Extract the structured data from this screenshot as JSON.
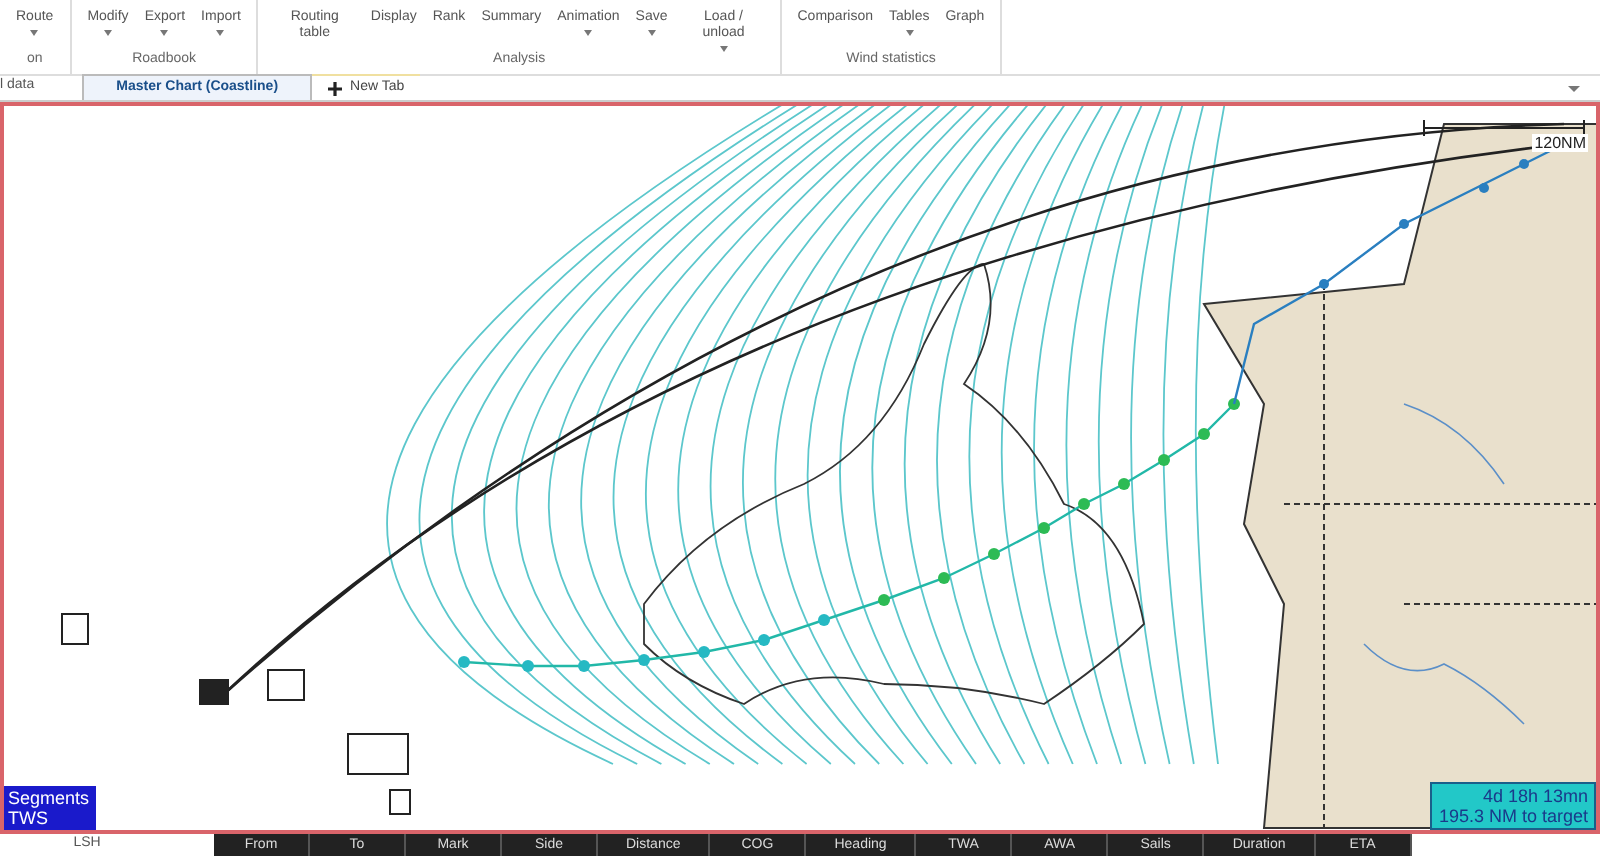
{
  "ribbon": {
    "groups": [
      {
        "label": "on",
        "buttons": [
          {
            "label": "Route",
            "dropdown": true
          }
        ]
      },
      {
        "label": "Roadbook",
        "buttons": [
          {
            "label": "Modify",
            "dropdown": true
          },
          {
            "label": "Export",
            "dropdown": true
          },
          {
            "label": "Import",
            "dropdown": true
          }
        ]
      },
      {
        "label": "Analysis",
        "buttons": [
          {
            "label": "Routing table",
            "dropdown": false
          },
          {
            "label": "Display",
            "dropdown": false
          },
          {
            "label": "Rank",
            "dropdown": false
          },
          {
            "label": "Summary",
            "dropdown": false
          },
          {
            "label": "Animation",
            "dropdown": true
          },
          {
            "label": "Save",
            "dropdown": true
          },
          {
            "label": "Load / unload",
            "dropdown": true
          }
        ]
      },
      {
        "label": "Wind statistics",
        "buttons": [
          {
            "label": "Comparison",
            "dropdown": false
          },
          {
            "label": "Tables",
            "dropdown": true
          },
          {
            "label": "Graph",
            "dropdown": false
          }
        ]
      }
    ]
  },
  "tabs": [
    {
      "label": "l data",
      "selected": false
    },
    {
      "label": "Master Chart (Coastline)",
      "selected": true
    }
  ],
  "new_tab": {
    "label": "New Tab"
  },
  "chart": {
    "scale_label": "120NM",
    "legend": [
      "Segments",
      "TWS"
    ],
    "eta_box": [
      "4d 18h 13mn",
      "195.3 NM to target"
    ]
  },
  "bottom": {
    "side_label": "LSH",
    "columns": [
      "From",
      "To",
      "Mark",
      "Side",
      "Distance",
      "COG",
      "Heading",
      "TWA",
      "AWA",
      "Sails",
      "Duration",
      "ETA"
    ]
  }
}
